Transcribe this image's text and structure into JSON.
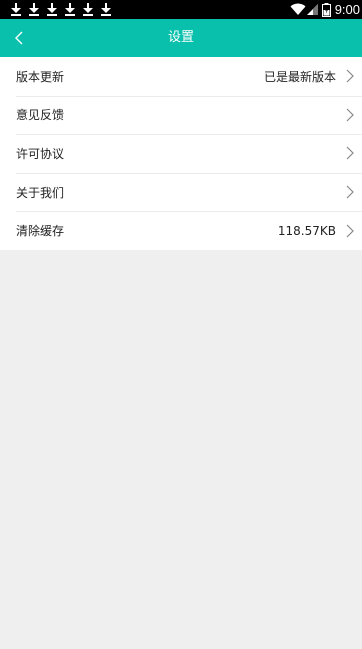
{
  "status_bar": {
    "time": "9:00",
    "notifications": [
      "download-icon",
      "download-icon",
      "download-icon",
      "download-icon",
      "download-icon",
      "download-icon"
    ],
    "icons": [
      "wifi-icon",
      "signal-icon",
      "battery-icon"
    ]
  },
  "app_bar": {
    "title": "设置",
    "back_icon": "chevron-left-icon",
    "background": "#08c0ac"
  },
  "settings": {
    "items": [
      {
        "label": "版本更新",
        "value": "已是最新版本"
      },
      {
        "label": "意见反馈",
        "value": ""
      },
      {
        "label": "许可协议",
        "value": ""
      },
      {
        "label": "关于我们",
        "value": ""
      },
      {
        "label": "清除缓存",
        "value": "118.57KB"
      }
    ]
  }
}
